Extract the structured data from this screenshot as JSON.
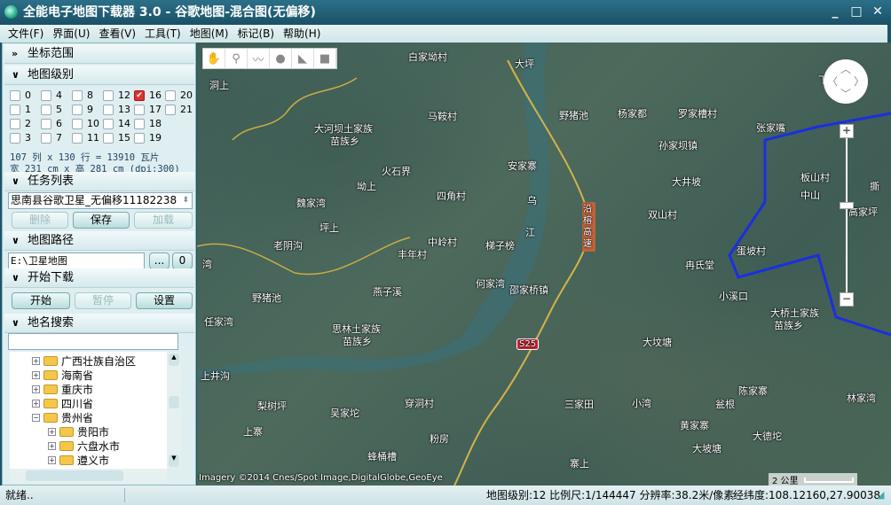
{
  "window": {
    "title": "全能电子地图下载器 3.0 - 谷歌地图-混合图(无偏移)",
    "minimize": "_",
    "maximize": "□",
    "close": "✕"
  },
  "menu": [
    "文件(F)",
    "界面(U)",
    "查看(V)",
    "工具(T)",
    "地图(M)",
    "标记(B)",
    "帮助(H)"
  ],
  "left": {
    "coord_header": "坐标范围",
    "level_header": "地图级别",
    "levels": [
      {
        "n": "0"
      },
      {
        "n": "4"
      },
      {
        "n": "8"
      },
      {
        "n": "12"
      },
      {
        "n": "16",
        "checked": true
      },
      {
        "n": "20"
      },
      {
        "n": "1"
      },
      {
        "n": "5"
      },
      {
        "n": "9"
      },
      {
        "n": "13"
      },
      {
        "n": "17"
      },
      {
        "n": "21"
      },
      {
        "n": "2"
      },
      {
        "n": "6"
      },
      {
        "n": "10"
      },
      {
        "n": "14"
      },
      {
        "n": "18"
      },
      {
        "n": "3"
      },
      {
        "n": "7"
      },
      {
        "n": "11"
      },
      {
        "n": "15"
      },
      {
        "n": "19"
      }
    ],
    "tile_info": "107 列 x 130 行 = 13910 瓦片",
    "size_info": "宽 231 cm x 高 281 cm (dpi:300)",
    "task_header": "任务列表",
    "task_value": "思南县谷歌卫星_无偏移11182238",
    "delete": "删除",
    "save": "保存",
    "load": "加载",
    "path_header": "地图路径",
    "path_value": "E:\\卫星地图",
    "browse": "...",
    "open": "0",
    "download_header": "开始下载",
    "start": "开始",
    "pause": "暂停",
    "settings": "设置",
    "search_header": "地名搜索",
    "search_value": "",
    "tree": [
      {
        "label": "广西壮族自治区",
        "sign": "+",
        "depth": 0
      },
      {
        "label": "海南省",
        "sign": "+",
        "depth": 0
      },
      {
        "label": "重庆市",
        "sign": "+",
        "depth": 0
      },
      {
        "label": "四川省",
        "sign": "+",
        "depth": 0
      },
      {
        "label": "贵州省",
        "sign": "−",
        "depth": 0
      },
      {
        "label": "贵阳市",
        "sign": "+",
        "depth": 1
      },
      {
        "label": "六盘水市",
        "sign": "+",
        "depth": 1
      },
      {
        "label": "遵义市",
        "sign": "+",
        "depth": 1
      }
    ]
  },
  "map": {
    "tools": [
      "hand-icon",
      "marker-icon",
      "polyline-icon",
      "circle-icon",
      "polygon-icon",
      "rectangle-icon"
    ],
    "labels": [
      "白家坳村",
      "大坪",
      "洞上",
      "马鞍村",
      "野猪池",
      "杨家都",
      "罗家槽村",
      "张家嘴",
      "大河坝土家族",
      "苗族乡",
      "孙家坝镇",
      "安家寨",
      "火石界",
      "板山村",
      "坳上",
      "大井坡",
      "四角村",
      "中山",
      "撕",
      "魏家湾",
      "双山村",
      "高家坪",
      "坪上",
      "中岭村",
      "梯子榜",
      "老阴沟",
      "丰年村",
      "蛋坡村",
      "冉氏堂",
      "湾",
      "何家湾",
      "燕子溪",
      "邵家桥镇",
      "野猪池",
      "小溪口",
      "大桥土家族",
      "苗族乡",
      "任家湾",
      "思林土家族",
      "苗族乡",
      "大坟塘",
      "上井沟",
      "陈家寨",
      "林家湾",
      "梨树坪",
      "三家田",
      "小湾",
      "瓮根",
      "吴家坨",
      "穿洞村",
      "黄家寨",
      "大德坨",
      "上寨",
      "粉房",
      "大坡塘",
      "蜂桶槽",
      "寨上",
      "乌",
      "江",
      "下"
    ],
    "highway": "沿榕高速",
    "road_shield": "S25",
    "attribution": "Imagery ©2014 Cnes/Spot Image,DigitalGlobe,GeoEye",
    "scale": "2 公里"
  },
  "status": {
    "ready": "就绪..",
    "info": "地图级别:12 比例尺:1/144447 分辨率:38.2米/像素",
    "coords": "经纬度:108.12160,27.90038"
  }
}
